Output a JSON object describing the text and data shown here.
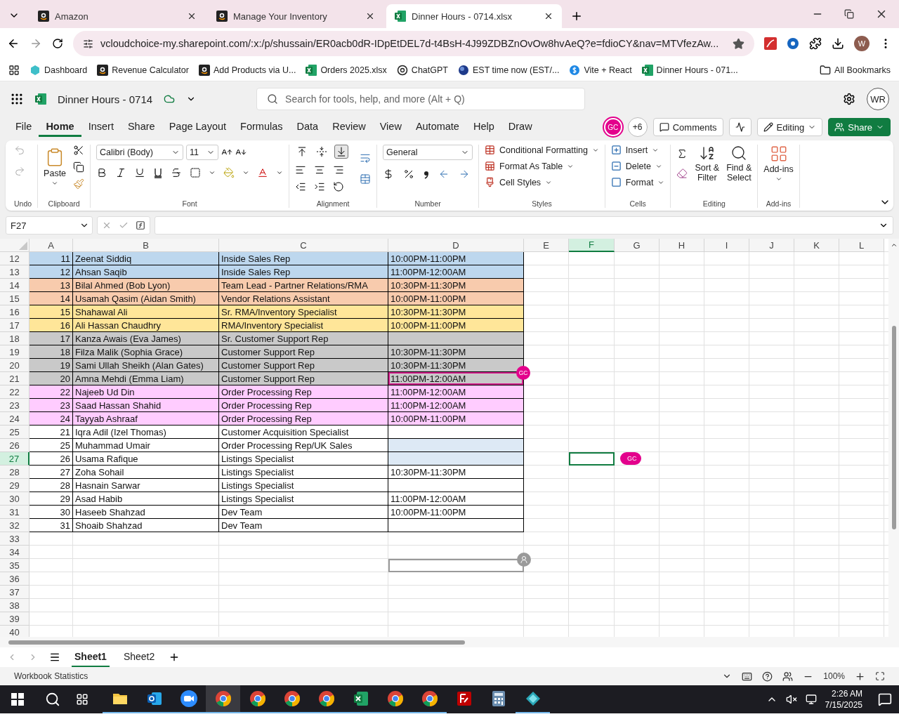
{
  "browser": {
    "tabs": [
      {
        "title": "Amazon",
        "kind": "amazon",
        "selected": false
      },
      {
        "title": "Manage Your Inventory",
        "kind": "amazon",
        "selected": false
      },
      {
        "title": "Dinner Hours - 0714.xlsx",
        "kind": "excel",
        "selected": true
      }
    ],
    "url": "vcloudchoice-my.sharepoint.com/:x:/p/shussain/ER0acb0dR-IDpEtDEL7d-t4BsH-4J99ZDBZnOvOw8hvAeQ?e=fdioCY&nav=MTVfezAw...",
    "profile": "W",
    "bookmarks": [
      {
        "label": "Dashboard",
        "kind": "hex"
      },
      {
        "label": "Revenue Calculator",
        "kind": "amazon"
      },
      {
        "label": "Add Products via U...",
        "kind": "amazon"
      },
      {
        "label": "Orders 2025.xlsx",
        "kind": "excel"
      },
      {
        "label": "ChatGPT",
        "kind": "chat"
      },
      {
        "label": "EST time now (EST/...",
        "kind": "globe"
      },
      {
        "label": "Vite + React",
        "kind": "dollar"
      },
      {
        "label": "Dinner Hours - 071...",
        "kind": "excel"
      }
    ],
    "all_bookmarks": "All Bookmarks"
  },
  "app": {
    "title": "Dinner Hours - 0714",
    "search": "Search for tools, help, and more (Alt + Q)",
    "user": "WR"
  },
  "ribbon": {
    "tabs": [
      {
        "label": "File",
        "selected": false
      },
      {
        "label": "Home",
        "selected": true
      },
      {
        "label": "Insert",
        "selected": false
      },
      {
        "label": "Share",
        "selected": false
      },
      {
        "label": "Page Layout",
        "selected": false
      },
      {
        "label": "Formulas",
        "selected": false
      },
      {
        "label": "Data",
        "selected": false
      },
      {
        "label": "Review",
        "selected": false
      },
      {
        "label": "View",
        "selected": false
      },
      {
        "label": "Automate",
        "selected": false
      },
      {
        "label": "Help",
        "selected": false
      },
      {
        "label": "Draw",
        "selected": false
      }
    ],
    "presence": "GC",
    "more": "+6",
    "comments": "Comments",
    "mode": "Editing",
    "share": "Share",
    "font": "Calibri (Body)",
    "size": "11",
    "number_format": "General",
    "vertical_align": [
      {
        "selected": false
      },
      {
        "selected": false
      },
      {
        "selected": true
      }
    ],
    "groups": [
      {
        "kind": "undo",
        "label": "Undo"
      },
      {
        "kind": "clipboard",
        "label": "Clipboard",
        "items": [
          "Paste"
        ]
      },
      {
        "kind": "font",
        "label": "Font"
      },
      {
        "kind": "alignment",
        "label": "Alignment"
      },
      {
        "kind": "number",
        "label": "Number"
      },
      {
        "kind": "styles",
        "label": "Styles",
        "items": [
          "Conditional Formatting",
          "Format As Table",
          "Cell Styles"
        ]
      },
      {
        "kind": "cells",
        "label": "Cells",
        "items": [
          "Insert",
          "Delete",
          "Format"
        ]
      },
      {
        "kind": "editing",
        "label": "Editing",
        "items": [
          "Sort &\nFilter",
          "Find &\nSelect"
        ]
      },
      {
        "kind": "addins",
        "label": "Add-ins",
        "items": [
          "Add-ins"
        ]
      }
    ]
  },
  "formula_bar": {
    "name_box": "F27"
  },
  "sheet": {
    "columns": [
      {
        "label": "A",
        "selected": false
      },
      {
        "label": "B",
        "selected": false
      },
      {
        "label": "C",
        "selected": false
      },
      {
        "label": "D",
        "selected": false
      },
      {
        "label": "E",
        "selected": false
      },
      {
        "label": "F",
        "selected": true
      },
      {
        "label": "G",
        "selected": false
      },
      {
        "label": "H",
        "selected": false
      },
      {
        "label": "I",
        "selected": false
      },
      {
        "label": "J",
        "selected": false
      },
      {
        "label": "K",
        "selected": false
      },
      {
        "label": "L",
        "selected": false
      }
    ],
    "rows": [
      {
        "num": "12",
        "cells": [
          "11",
          "Zeenat Siddiq",
          "Inside Sales Rep",
          "10:00PM-11:00PM"
        ],
        "color": "#bdd7ee",
        "selected": false,
        "d_shaded": false
      },
      {
        "num": "13",
        "cells": [
          "12",
          "Ahsan Saqib",
          "Inside Sales Rep",
          "11:00PM-12:00AM"
        ],
        "color": "#bdd7ee",
        "selected": false,
        "d_shaded": false
      },
      {
        "num": "14",
        "cells": [
          "13",
          "Bilal Ahmed (Bob Lyon)",
          "Team Lead - Partner Relations/RMA",
          "10:30PM-11:30PM"
        ],
        "color": "#f8cbad",
        "selected": false,
        "d_shaded": false
      },
      {
        "num": "15",
        "cells": [
          "14",
          "Usamah Qasim (Aidan Smith)",
          "Vendor Relations Assistant",
          "10:00PM-11:00PM"
        ],
        "color": "#f8cbad",
        "selected": false,
        "d_shaded": false
      },
      {
        "num": "16",
        "cells": [
          "15",
          "Shahawal Ali",
          "Sr. RMA/Inventory Specialist",
          "10:30PM-11:30PM"
        ],
        "color": "#ffe699",
        "selected": false,
        "d_shaded": false
      },
      {
        "num": "17",
        "cells": [
          "16",
          "Ali Hassan Chaudhry",
          "RMA/Inventory Specialist",
          "10:00PM-11:00PM"
        ],
        "color": "#ffe699",
        "selected": false,
        "d_shaded": false
      },
      {
        "num": "18",
        "cells": [
          "17",
          "Kanza Awais (Eva James)",
          "Sr. Customer Support Rep"
        ],
        "color": "#c9c9c9",
        "selected": false,
        "d_shaded": false
      },
      {
        "num": "19",
        "cells": [
          "18",
          "Filza Malik (Sophia Grace)",
          "Customer Support Rep",
          "10:30PM-11:30PM"
        ],
        "color": "#c9c9c9",
        "selected": false,
        "d_shaded": false
      },
      {
        "num": "20",
        "cells": [
          "19",
          "Sami Ullah Sheikh (Alan Gates)",
          "Customer Support Rep",
          "10:30PM-11:30PM"
        ],
        "color": "#c9c9c9",
        "selected": false,
        "d_shaded": false
      },
      {
        "num": "21",
        "cells": [
          "20",
          "Amna Mehdi (Emma Liam)",
          "Customer Support Rep",
          "11:00PM-12:00AM"
        ],
        "color": "#c9c9c9",
        "selected": false,
        "d_shaded": false,
        "marker": {
          "kind": "cell",
          "text": "GC"
        }
      },
      {
        "num": "22",
        "cells": [
          "22",
          "Najeeb Ud Din",
          "Order Processing Rep",
          "11:00PM-12:00AM"
        ],
        "color": "#ffccff",
        "selected": false,
        "d_shaded": false
      },
      {
        "num": "23",
        "cells": [
          "23",
          "Saad Hassan Shahid",
          "Order Processing Rep",
          "11:00PM-12:00AM"
        ],
        "color": "#ffccff",
        "selected": false,
        "d_shaded": false
      },
      {
        "num": "24",
        "cells": [
          "24",
          "Tayyab Ashraaf",
          "Order Processing Rep",
          "10:00PM-11:00PM"
        ],
        "color": "#ffccff",
        "selected": false,
        "d_shaded": false
      },
      {
        "num": "25",
        "cells": [
          "21",
          "Iqra Adil (Izel Thomas)",
          "Customer Acquisition Specialist"
        ],
        "color": "#ffffff",
        "selected": false,
        "d_shaded": false
      },
      {
        "num": "26",
        "cells": [
          "25",
          "Muhammad Umair",
          "Order Processing Rep/UK Sales"
        ],
        "color": "#ffffff",
        "selected": false,
        "d_shaded": true
      },
      {
        "num": "27",
        "cells": [
          "26",
          "Usama Rafique",
          "Listings Specialist"
        ],
        "color": "#ffffff",
        "selected": true,
        "d_shaded": true,
        "marker": {
          "kind": "pill",
          "text": "GC"
        }
      },
      {
        "num": "28",
        "cells": [
          "27",
          "Zoha Sohail",
          "Listings Specialist",
          "10:30PM-11:30PM"
        ],
        "color": "#ffffff",
        "selected": false,
        "d_shaded": false
      },
      {
        "num": "29",
        "cells": [
          "28",
          "Hasnain Sarwar",
          "Listings Specialist"
        ],
        "color": "#ffffff",
        "selected": false,
        "d_shaded": false
      },
      {
        "num": "30",
        "cells": [
          "29",
          "Asad Habib",
          "Listings Specialist",
          "11:00PM-12:00AM"
        ],
        "color": "#ffffff",
        "selected": false,
        "d_shaded": false
      },
      {
        "num": "31",
        "cells": [
          "30",
          "Haseeb Shahzad",
          "Dev Team",
          "10:00PM-11:00PM"
        ],
        "color": "#ffffff",
        "selected": false,
        "d_shaded": false
      },
      {
        "num": "32",
        "cells": [
          "31",
          "Shoaib Shahzad",
          "Dev Team"
        ],
        "color": "#ffffff",
        "selected": false,
        "d_shaded": false
      },
      {
        "num": "33",
        "selected": false
      },
      {
        "num": "34",
        "selected": false
      },
      {
        "num": "35",
        "selected": false,
        "marker": {
          "kind": "anonymous"
        }
      },
      {
        "num": "36",
        "selected": false
      },
      {
        "num": "37",
        "selected": false
      },
      {
        "num": "38",
        "selected": false
      },
      {
        "num": "39",
        "selected": false
      },
      {
        "num": "40",
        "selected": false
      }
    ]
  },
  "sheets": [
    {
      "name": "Sheet1",
      "selected": true
    },
    {
      "name": "Sheet2",
      "selected": false
    }
  ],
  "status": {
    "left": "Workbook Statistics",
    "zoom": "100%"
  },
  "taskbar": {
    "apps": [
      {
        "kind": "folder",
        "running": true,
        "selected": false
      },
      {
        "kind": "mail",
        "running": true,
        "selected": false
      },
      {
        "kind": "video",
        "running": true,
        "selected": false
      },
      {
        "kind": "browser",
        "running": true,
        "selected": true
      },
      {
        "kind": "browser",
        "running": true,
        "selected": false
      },
      {
        "kind": "browser",
        "running": true,
        "selected": false
      },
      {
        "kind": "browser",
        "running": true,
        "selected": false
      },
      {
        "kind": "spreadsheet",
        "running": true,
        "selected": false
      },
      {
        "kind": "browser",
        "running": true,
        "selected": false
      },
      {
        "kind": "browser",
        "running": true,
        "selected": false
      },
      {
        "kind": "ftp",
        "running": false,
        "selected": false
      },
      {
        "kind": "calculator",
        "running": false,
        "selected": false
      },
      {
        "kind": "diamond",
        "running": true,
        "selected": false
      }
    ],
    "time": "2:26 AM",
    "date": "7/15/2025"
  }
}
